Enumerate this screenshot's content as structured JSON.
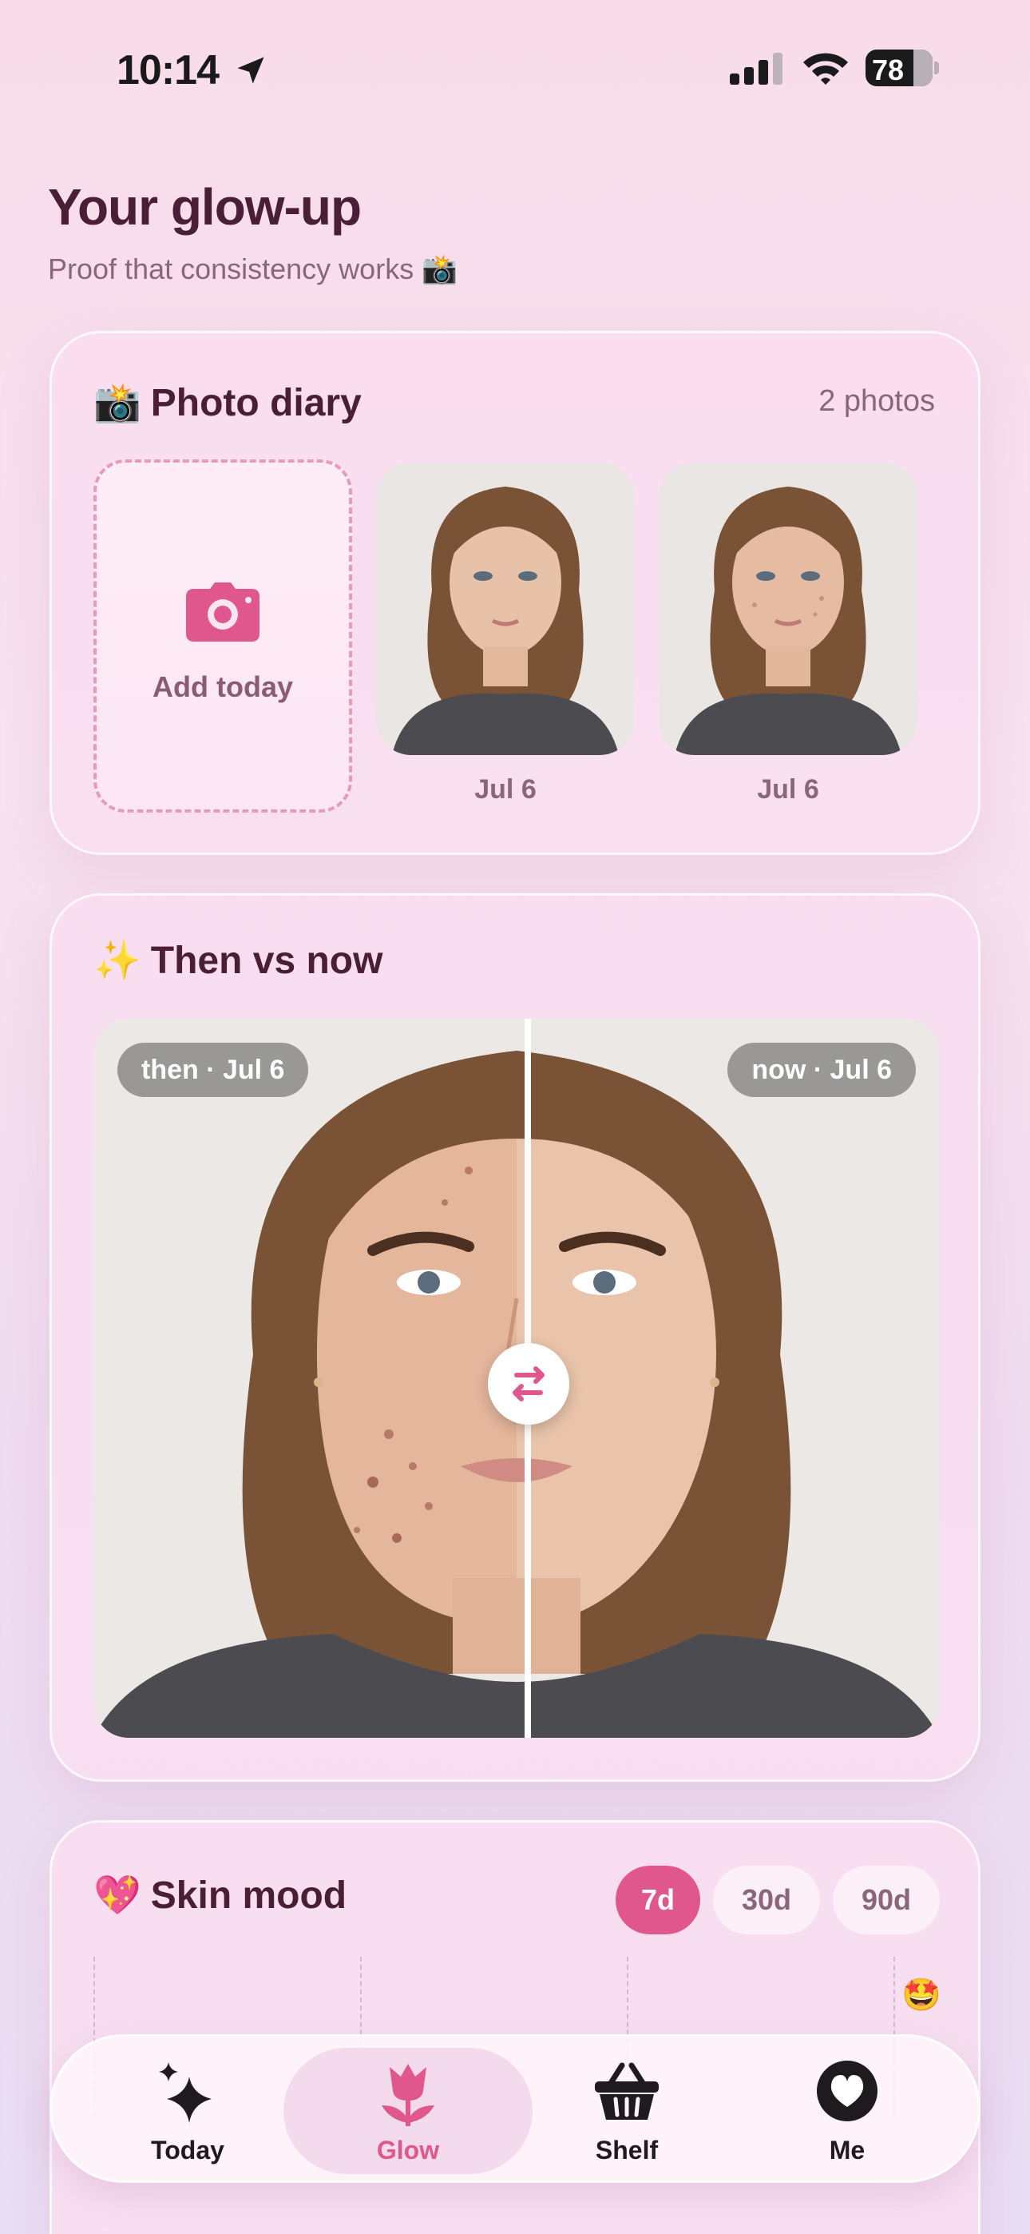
{
  "status_bar": {
    "time": "10:14",
    "battery": "78"
  },
  "header": {
    "title": "Your glow-up",
    "subtitle": "Proof that consistency works 📸"
  },
  "photo_diary": {
    "emoji": "📸",
    "title": "Photo diary",
    "count": "2 photos",
    "add_label": "Add today",
    "photos": [
      {
        "date": "Jul 6"
      },
      {
        "date": "Jul 6"
      }
    ]
  },
  "compare": {
    "emoji": "✨",
    "title": "Then vs now",
    "then_label": "then · Jul 6",
    "now_label": "now · Jul 6"
  },
  "skin_mood": {
    "emoji": "💖",
    "title": "Skin mood",
    "ranges": [
      "7d",
      "30d",
      "90d"
    ],
    "active_range": "7d",
    "latest_mood": "🤩"
  },
  "tabbar": {
    "tabs": [
      {
        "label": "Today",
        "icon": "sparkles-icon"
      },
      {
        "label": "Glow",
        "icon": "tulip-icon"
      },
      {
        "label": "Shelf",
        "icon": "basket-icon"
      },
      {
        "label": "Me",
        "icon": "heart-icon"
      }
    ],
    "active": "Glow"
  },
  "colors": {
    "accent": "#e0578e",
    "title_text": "#4a1f36",
    "muted_text": "#8a6678"
  }
}
